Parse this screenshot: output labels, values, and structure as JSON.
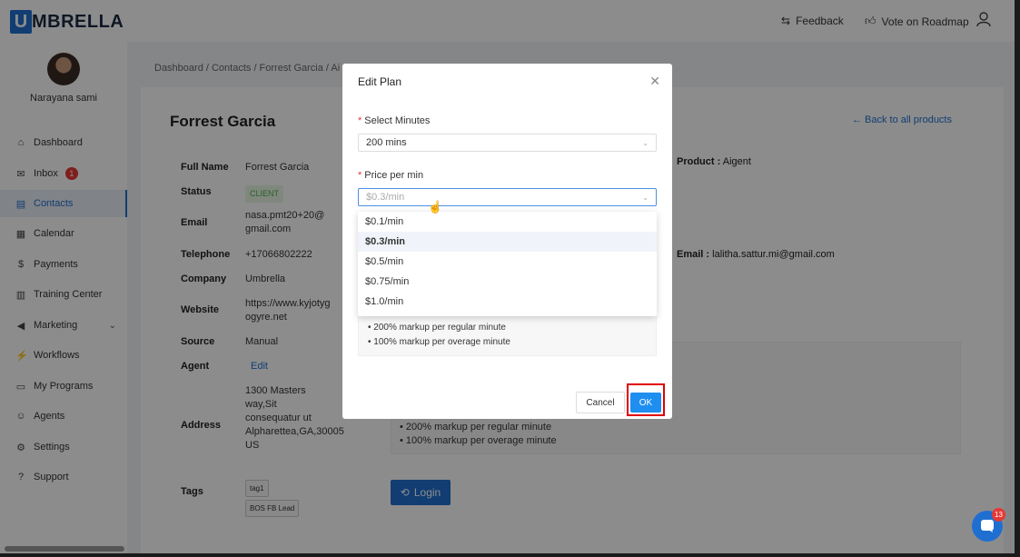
{
  "app": {
    "logo_letter": "U",
    "logo_rest": "MBRELLA"
  },
  "topbar": {
    "feedback": "Feedback",
    "vote": "Vote on Roadmap"
  },
  "sidebar": {
    "user_name": "Narayana sami",
    "items": [
      {
        "label": "Dashboard",
        "icon": "⌂"
      },
      {
        "label": "Inbox",
        "icon": "✉",
        "badge": "1"
      },
      {
        "label": "Contacts",
        "icon": "▤"
      },
      {
        "label": "Calendar",
        "icon": "▦"
      },
      {
        "label": "Payments",
        "icon": "$"
      },
      {
        "label": "Training Center",
        "icon": "▥"
      },
      {
        "label": "Marketing",
        "icon": "◀"
      },
      {
        "label": "Workflows",
        "icon": "⚡"
      },
      {
        "label": "My Programs",
        "icon": "▭"
      },
      {
        "label": "Agents",
        "icon": "☺"
      },
      {
        "label": "Settings",
        "icon": "⚙"
      },
      {
        "label": "Support",
        "icon": "?"
      }
    ]
  },
  "breadcrumb": "Dashboard  /  Contacts  /  Forrest Garcia  /  Ai",
  "contact": {
    "title": "Forrest Garcia",
    "back_link": "Back to all products",
    "fields": [
      {
        "label": "Full Name",
        "value": "Forrest Garcia"
      },
      {
        "label": "Status",
        "value": "CLIENT"
      },
      {
        "label": "Email",
        "value": "nasa.pmt20+20@gmail.com"
      },
      {
        "label": "Telephone",
        "value": "+17066802222"
      },
      {
        "label": "Company",
        "value": "Umbrella"
      },
      {
        "label": "Website",
        "value": "https://www.kyjotygogyre.net"
      },
      {
        "label": "Source",
        "value": "Manual"
      },
      {
        "label": "Agent",
        "value": "Edit"
      },
      {
        "label": "Address",
        "value": "1300 Masters way,Sit consequatur ut Alpharettea,GA,30005 US"
      },
      {
        "label": "Tags",
        "value": ""
      }
    ],
    "tags": [
      "tag1",
      "BOS FB Lead"
    ],
    "product_label": "Product :",
    "product_value": "Aigent",
    "email_label": "Email :",
    "email_value": "lalitha.sattur.mi@gmail.com",
    "plan_lines": [
      "• 200% markup per regular minute",
      "• 100% markup per overage minute"
    ],
    "login_label": "Login"
  },
  "modal": {
    "title": "Edit Plan",
    "minutes_label": "Select Minutes",
    "minutes_value": "200 mins",
    "price_label": "Price per min",
    "price_placeholder": "$0.3/min",
    "options": [
      "$0.1/min",
      "$0.3/min",
      "$0.5/min",
      "$0.75/min",
      "$1.0/min"
    ],
    "info_lines": [
      "• 200% markup per regular minute",
      "• 100% markup per overage minute"
    ],
    "cancel_label": "Cancel",
    "ok_label": "OK"
  },
  "chat": {
    "badge": "13"
  }
}
